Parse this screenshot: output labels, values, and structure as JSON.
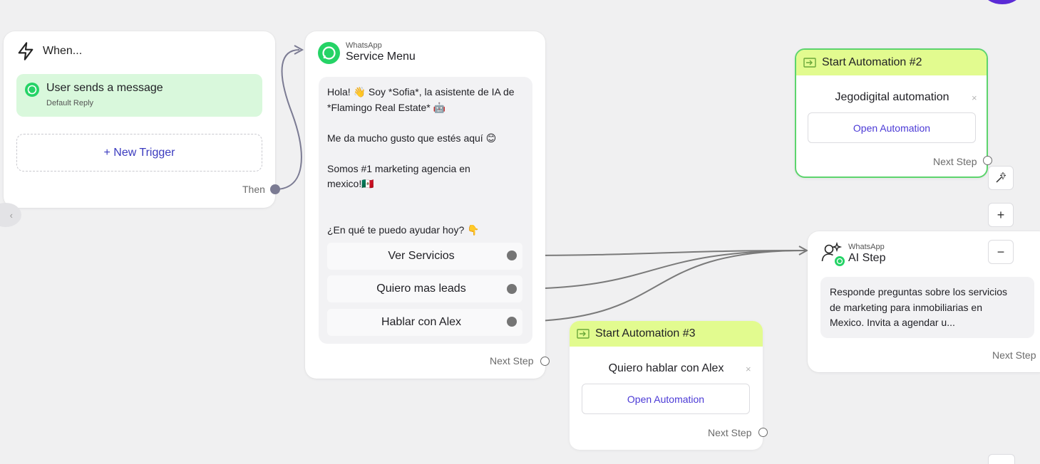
{
  "trigger": {
    "header": "When...",
    "item_title": "User sends a message",
    "item_subtitle": "Default Reply",
    "new_trigger": "+ New Trigger",
    "then_label": "Then"
  },
  "service_menu": {
    "channel": "WhatsApp",
    "title": "Service Menu",
    "message_lines": [
      "Hola! 👋 Soy *Sofia*, la asistente de IA de",
      "*Flamingo Real Estate* 🤖",
      "",
      "Me da mucho gusto que estés aquí 😊",
      "",
      "Somos #1 marketing agencia en",
      "mexico!🇲🇽",
      "",
      "",
      "¿En qué te puedo ayudar hoy? 👇"
    ],
    "buttons": [
      "Ver Servicios",
      "Quiero mas leads",
      "Hablar con Alex"
    ],
    "next_step": "Next Step"
  },
  "automation_2": {
    "title": "Start Automation #2",
    "name": "Jegodigital automation",
    "close": "×",
    "open_label": "Open Automation",
    "next_step": "Next Step"
  },
  "automation_3": {
    "title": "Start Automation #3",
    "name": "Quiero hablar con Alex",
    "close": "×",
    "open_label": "Open Automation",
    "next_step": "Next Step"
  },
  "ai_step": {
    "channel": "WhatsApp",
    "title": "AI Step",
    "description_lines": [
      "Responde preguntas sobre los servicios",
      "de marketing para inmobiliarias en",
      "Mexico. Invita a agendar u..."
    ],
    "next_step": "Next Step"
  },
  "toolbar": {
    "magic": "magic-wand-icon",
    "zoom_in": "+",
    "zoom_out": "−"
  },
  "colors": {
    "whatsapp_green": "#25d366",
    "automation_bar": "#e2fb8f",
    "trigger_bg": "#d9f8dc",
    "link_purple": "#4b3ad6",
    "selected_border": "#5dd46d"
  }
}
